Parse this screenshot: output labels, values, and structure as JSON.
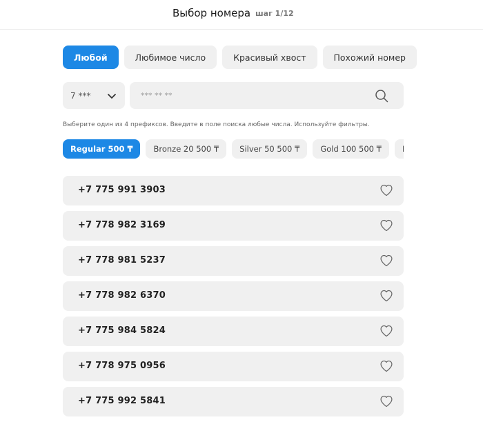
{
  "header": {
    "title": "Выбор номера",
    "step": "шаг 1/12"
  },
  "tabs": [
    {
      "label": "Любой",
      "active": true
    },
    {
      "label": "Любимое число",
      "active": false
    },
    {
      "label": "Красивый хвост",
      "active": false
    },
    {
      "label": "Похожий номер",
      "active": false
    }
  ],
  "prefix": {
    "value": "7 ***",
    "icon": "chevron-down-icon"
  },
  "search": {
    "placeholder": "*** ** **",
    "value": "",
    "icon": "search-icon"
  },
  "hint": "Выберите один из 4 префиксов. Введите в поле поиска любые числа. Используйте фильтры.",
  "chips": [
    {
      "label": "Regular 500 ₸",
      "active": true
    },
    {
      "label": "Bronze 20 500 ₸",
      "active": false
    },
    {
      "label": "Silver 50 500 ₸",
      "active": false
    },
    {
      "label": "Gold 100 500 ₸",
      "active": false
    },
    {
      "label": "Pla",
      "active": false
    }
  ],
  "numbers": [
    "+7 775 991 3903",
    "+7 778 982 3169",
    "+7 778 981 5237",
    "+7 778 982 6370",
    "+7 775 984 5824",
    "+7 778 975 0956",
    "+7 775 992 5841"
  ],
  "colors": {
    "accent": "#1d88e5",
    "surface": "#f0f0f0",
    "text": "#1f1f1f"
  }
}
